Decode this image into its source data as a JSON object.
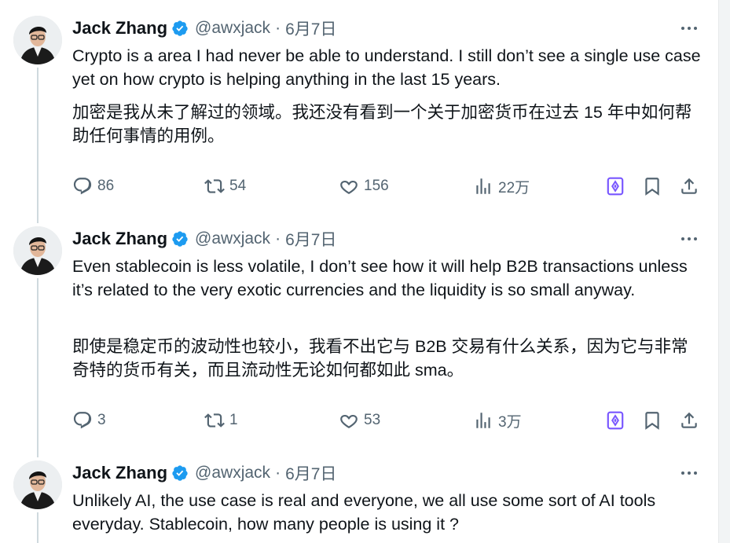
{
  "tweets": [
    {
      "name": "Jack Zhang",
      "handle": "@awxjack",
      "sep": "·",
      "date": "6月7日",
      "text_en": "Crypto is a area I had never be able to understand. I still don’t see a single use case yet on how crypto is helping anything in the last 15 years.",
      "text_zh": "加密是我从未了解过的领域。我还没有看到一个关于加密货币在过去 15 年中如何帮助任何事情的用例。",
      "replies": "86",
      "reposts": "54",
      "likes": "156",
      "views": "22万"
    },
    {
      "name": "Jack Zhang",
      "handle": "@awxjack",
      "sep": "·",
      "date": "6月7日",
      "text_en": "Even stablecoin is less volatile, I don’t see how it will help B2B transactions unless it’s related to the very exotic currencies and the liquidity is so small anyway.",
      "text_zh": "即使是稳定币的波动性也较小，我看不出它与 B2B 交易有什么关系，因为它与非常奇特的货币有关，而且流动性无论如何都如此 sma。",
      "replies": "3",
      "reposts": "1",
      "likes": "53",
      "views": "3万"
    },
    {
      "name": "Jack Zhang",
      "handle": "@awxjack",
      "sep": "·",
      "date": "6月7日",
      "text_en": "Unlikely AI, the use case is real and everyone, we all use some sort of AI tools everyday. Stablecoin, how many people is using it ?"
    }
  ],
  "colors": {
    "verified": "#1d9bf0",
    "secondary_text": "#536471",
    "grok_accent": "#7856ff",
    "thread_line": "#cfd9de"
  },
  "icons": [
    "reply-icon",
    "repost-icon",
    "like-icon",
    "views-icon",
    "grok-icon",
    "bookmark-icon",
    "share-icon",
    "verified-badge-icon",
    "more-icon"
  ]
}
